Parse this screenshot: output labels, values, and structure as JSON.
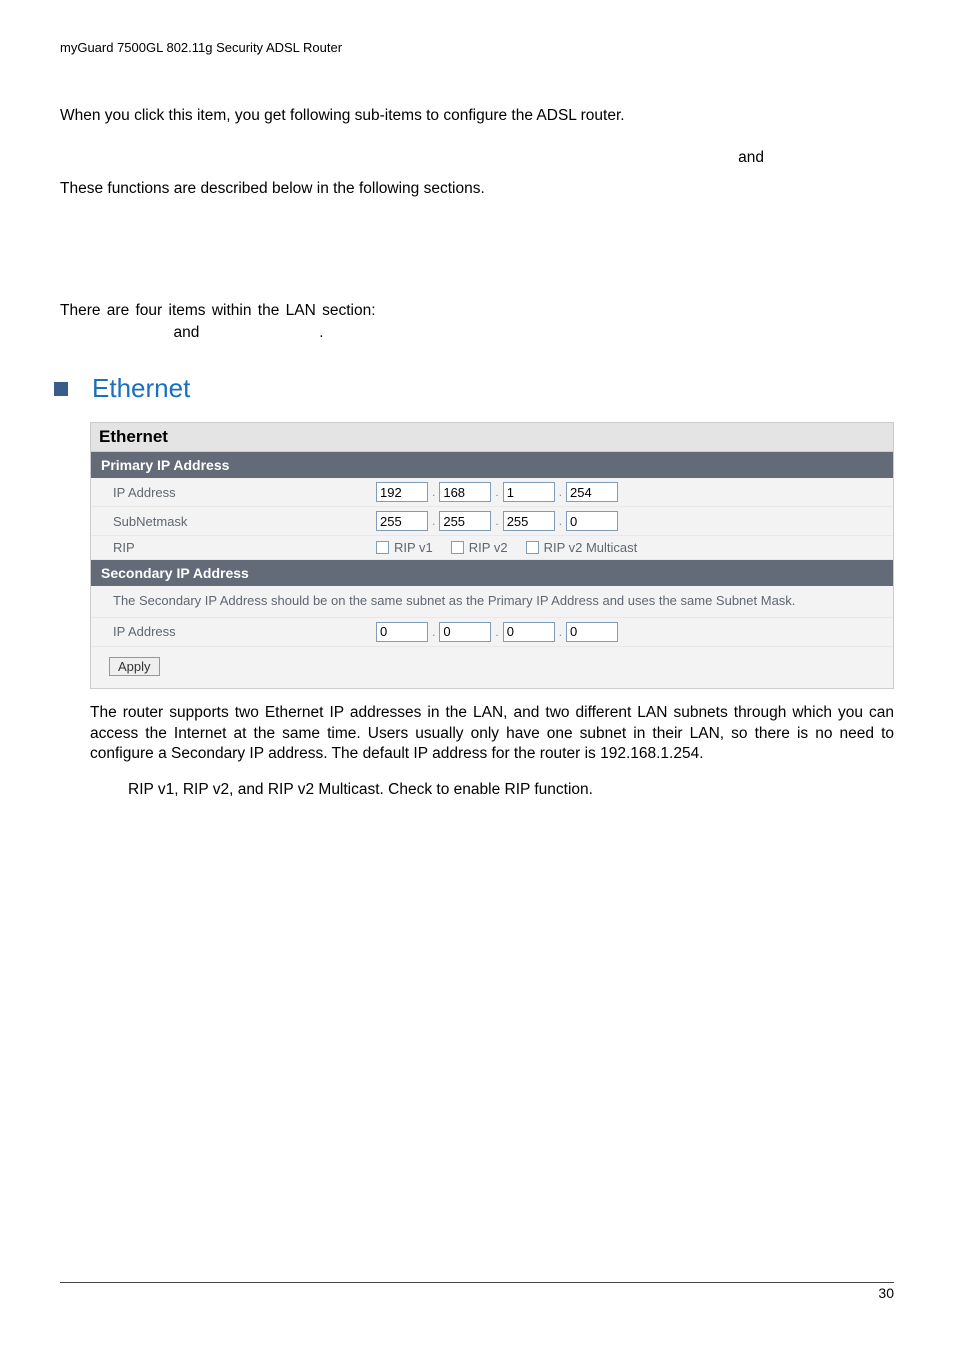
{
  "header": "myGuard 7500GL 802.11g Security ADSL Router",
  "intro_line": "When you click this item, you get following sub-items to configure the ADSL router.",
  "and_word": "and",
  "intro_line2": "These functions are described below in the following sections.",
  "lan_intro_prefix": "There are four items within the LAN section:",
  "lan_intro_and": "and",
  "lan_intro_dot": ".",
  "section_heading": "Ethernet",
  "panel": {
    "title": "Ethernet",
    "primary_header": "Primary IP Address",
    "ip_label": "IP Address",
    "subnet_label": "SubNetmask",
    "rip_label": "RIP",
    "secondary_header": "Secondary IP Address",
    "secondary_note": "The Secondary IP Address should be on the same subnet as the Primary IP Address and uses the same Subnet Mask.",
    "ip2_label": "IP Address",
    "apply_label": "Apply",
    "rip_v1": "RIP v1",
    "rip_v2": "RIP v2",
    "rip_v2m": "RIP v2 Multicast",
    "ip": [
      "192",
      "168",
      "1",
      "254"
    ],
    "mask": [
      "255",
      "255",
      "255",
      "0"
    ],
    "ip2": [
      "0",
      "0",
      "0",
      "0"
    ]
  },
  "desc_below": "The router supports two Ethernet IP addresses in the LAN, and two different LAN subnets through which you can access the Internet at the same time. Users usually only have one subnet in their LAN, so there is no need to configure a Secondary IP address. The default IP address for the router is 192.168.1.254.",
  "rip_note": "RIP v1, RIP v2, and RIP v2 Multicast. Check to enable RIP function.",
  "page_number": "30"
}
